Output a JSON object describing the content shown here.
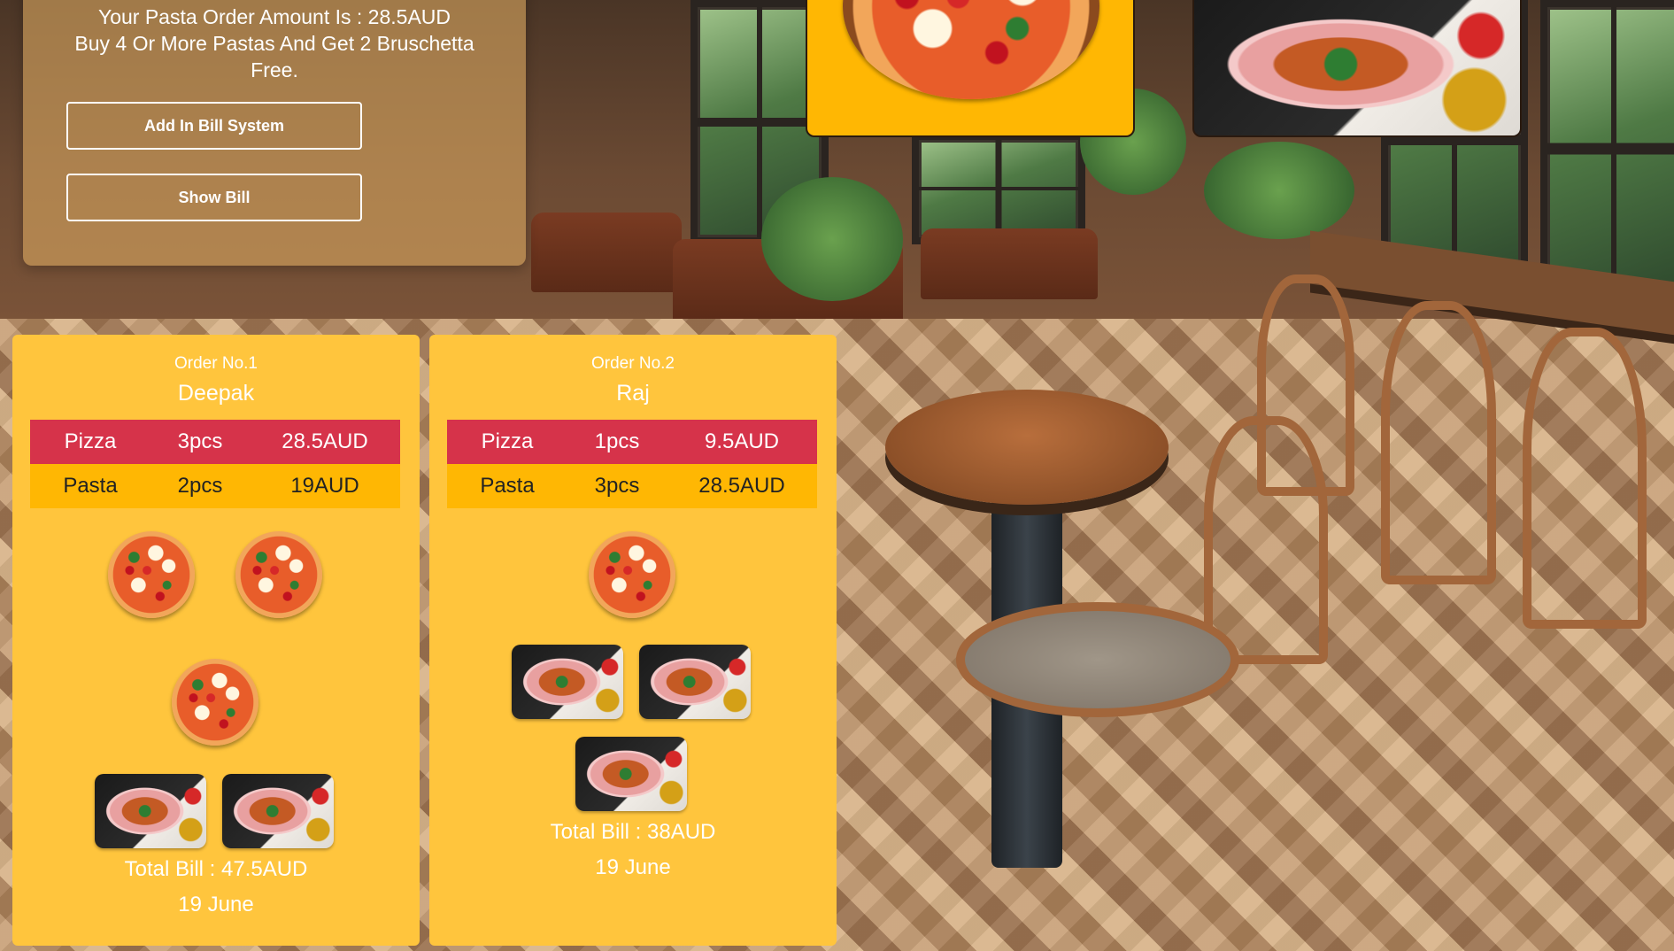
{
  "promo": {
    "line1": "Your Pasta Order Amount Is : 28.5AUD",
    "line2": "Buy 4 Or More Pastas And Get 2 Bruschetta",
    "line3": "Free."
  },
  "buttons": {
    "add_bill": "Add In Bill System",
    "show_bill": "Show Bill"
  },
  "menu_cards": [
    {
      "icon": "pizza-icon"
    },
    {
      "icon": "pasta-icon"
    }
  ],
  "orders": [
    {
      "order_no": "Order No.1",
      "customer": "Deepak",
      "items": [
        {
          "name": "Pizza",
          "qty": "3pcs",
          "price": "28.5AUD"
        },
        {
          "name": "Pasta",
          "qty": "2pcs",
          "price": "19AUD"
        }
      ],
      "pizza_count": 3,
      "pasta_count": 2,
      "total": "Total Bill : 47.5AUD",
      "date": "19 June"
    },
    {
      "order_no": "Order No.2",
      "customer": "Raj",
      "items": [
        {
          "name": "Pizza",
          "qty": "1pcs",
          "price": "9.5AUD"
        },
        {
          "name": "Pasta",
          "qty": "3pcs",
          "price": "28.5AUD"
        }
      ],
      "pizza_count": 1,
      "pasta_count": 3,
      "total": "Total Bill : 38AUD",
      "date": "19 June"
    }
  ],
  "colors": {
    "card_bg": "#ffc53d",
    "row_red": "#d6334a",
    "row_yellow": "#ffb703",
    "panel_bg": "rgba(214,164,96,0.62)"
  }
}
